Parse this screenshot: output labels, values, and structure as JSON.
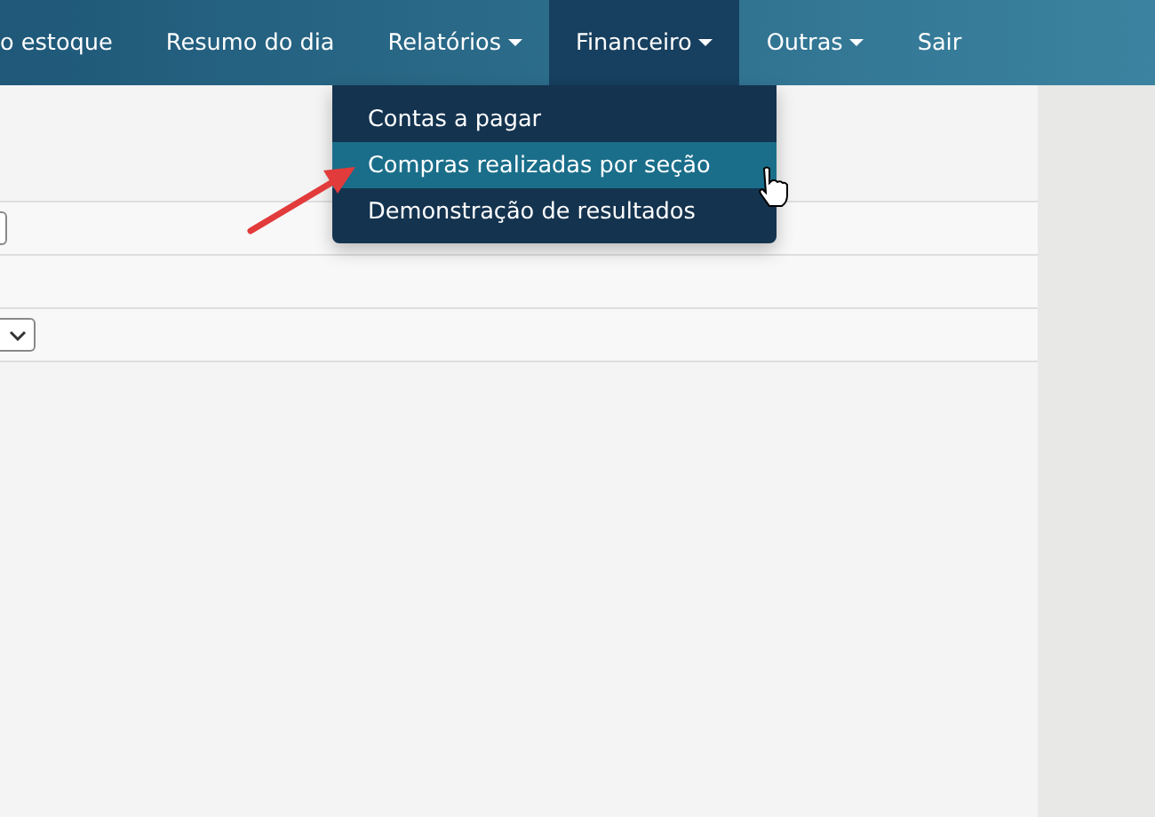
{
  "navbar": {
    "items": [
      {
        "label": "o estoque",
        "kind": "link",
        "selected": false
      },
      {
        "label": "Resumo do dia",
        "kind": "link",
        "selected": false
      },
      {
        "label": "Relatórios",
        "kind": "dropdown",
        "selected": false
      },
      {
        "label": "Financeiro",
        "kind": "dropdown",
        "selected": true
      },
      {
        "label": "Outras",
        "kind": "dropdown",
        "selected": false
      },
      {
        "label": "Sair",
        "kind": "link",
        "selected": false
      }
    ]
  },
  "dropdown_menu": {
    "items": [
      {
        "label": "Contas a pagar",
        "selected": false
      },
      {
        "label": "Compras realizadas por seção",
        "selected": true
      },
      {
        "label": "Demonstração de resultados",
        "selected": false
      }
    ]
  },
  "form_rows": [
    {
      "kind": "input"
    },
    {
      "kind": "empty"
    },
    {
      "kind": "select"
    }
  ]
}
